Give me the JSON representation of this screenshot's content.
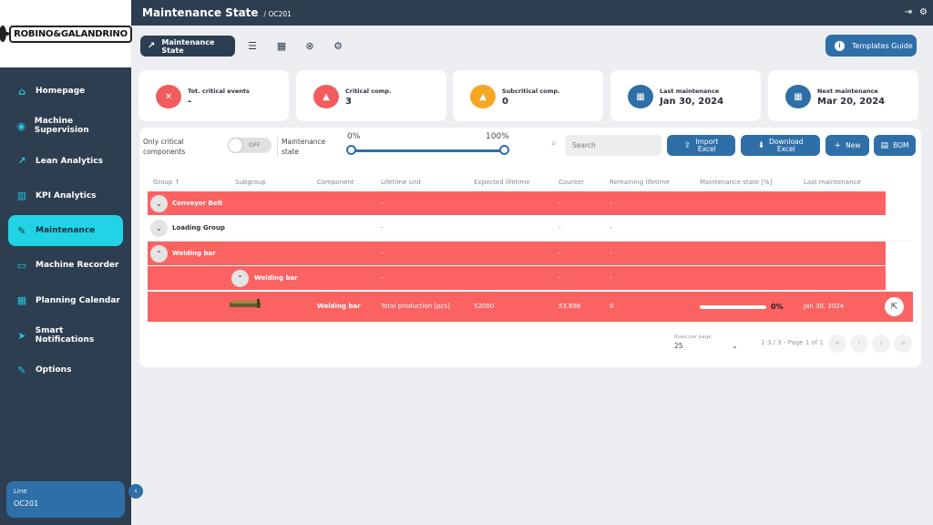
{
  "brand": {
    "logo_text": "ROBINO&GALANDRINO"
  },
  "header": {
    "title": "Maintenance State",
    "subtitle": "/ OC201"
  },
  "sidebar": {
    "items": [
      {
        "label": "Homepage",
        "icon": "home-icon",
        "glyph": "⌂",
        "active": false
      },
      {
        "label": "Machine Supervision",
        "icon": "eye-icon",
        "glyph": "◉",
        "active": false
      },
      {
        "label": "Lean Analytics",
        "icon": "trend-icon",
        "glyph": "↗",
        "active": false
      },
      {
        "label": "KPI Analytics",
        "icon": "bar-chart-icon",
        "glyph": "▥",
        "active": false
      },
      {
        "label": "Maintenance",
        "icon": "wrench-icon",
        "glyph": "✎",
        "active": true
      },
      {
        "label": "Machine Recorder",
        "icon": "recorder-icon",
        "glyph": "▭",
        "active": false
      },
      {
        "label": "Planning Calendar",
        "icon": "calendar-icon",
        "glyph": "▦",
        "active": false
      },
      {
        "label": "Smart Notifications",
        "icon": "send-icon",
        "glyph": "➤",
        "active": false
      },
      {
        "label": "Options",
        "icon": "wrench-icon",
        "glyph": "✎",
        "active": false
      }
    ],
    "line": {
      "label": "Line",
      "value": "OC201"
    }
  },
  "toolbar": {
    "active_tab": "Maintenance State",
    "templates_button": "Templates Guide"
  },
  "cards": [
    {
      "label": "Tot. critical events",
      "value": "-",
      "color": "#f25c5c",
      "icon": "close-circle-icon",
      "glyph": "✕"
    },
    {
      "label": "Critical comp.",
      "value": "3",
      "color": "#f25c5c",
      "icon": "warning-icon",
      "glyph": "▲"
    },
    {
      "label": "Subcritical comp.",
      "value": "0",
      "color": "#f5a623",
      "icon": "warning-icon",
      "glyph": "▲"
    },
    {
      "label": "Last maintenance",
      "value": "Jan 30, 2024",
      "color": "#2f6fa8",
      "icon": "calendar-icon",
      "glyph": "▦"
    },
    {
      "label": "Next maintenance",
      "value": "Mar 20, 2024",
      "color": "#2f6fa8",
      "icon": "calendar-icon",
      "glyph": "▦"
    }
  ],
  "filters": {
    "only_critical_l1": "Only critical",
    "only_critical_l2": "components",
    "toggle_text": "OFF",
    "state_l1": "Maintenance",
    "state_l2": "state",
    "slider_min": "0%",
    "slider_max": "100%",
    "search_placeholder": "Search"
  },
  "actions": {
    "import_l1": "Import",
    "import_l2": "Excel",
    "download_l1": "Download",
    "download_l2": "Excel",
    "new": "New",
    "bom": "BOM"
  },
  "table": {
    "headers": [
      "Group ↑",
      "Subgroup",
      "Component",
      "Lifetime unit",
      "Expected lifetime",
      "Counter",
      "Remaining lifetime",
      "Maintenance state [%]",
      "Last maintenance"
    ],
    "rows": [
      {
        "group": "Conveyor Belt",
        "lifetime_unit": "-",
        "counter": "-",
        "remaining": "-"
      },
      {
        "group": "Loading Group",
        "lifetime_unit": "-",
        "counter": "-",
        "remaining": "-"
      },
      {
        "group": "Welding bar",
        "lifetime_unit": "-",
        "counter": "-",
        "remaining": "-"
      },
      {
        "subgroup": "Welding bar",
        "lifetime_unit": "-",
        "counter": "-",
        "remaining": "-"
      },
      {
        "component": "Welding bar",
        "lifetime_unit": "Total production [pcs]",
        "expected": "52000",
        "counter": "53,698",
        "remaining": "0",
        "state_pct": "0%",
        "state_value": 0,
        "last": "Jan 30, 2024"
      }
    ]
  },
  "pager": {
    "rows_label": "Rows per page",
    "rows_value": "25",
    "info": "1-3 / 3 - Page 1 of 1"
  },
  "colors": {
    "sidebar": "#2d3e50",
    "accent": "#22d3e6",
    "primary": "#2f6fa8",
    "critical": "#fb6262"
  }
}
